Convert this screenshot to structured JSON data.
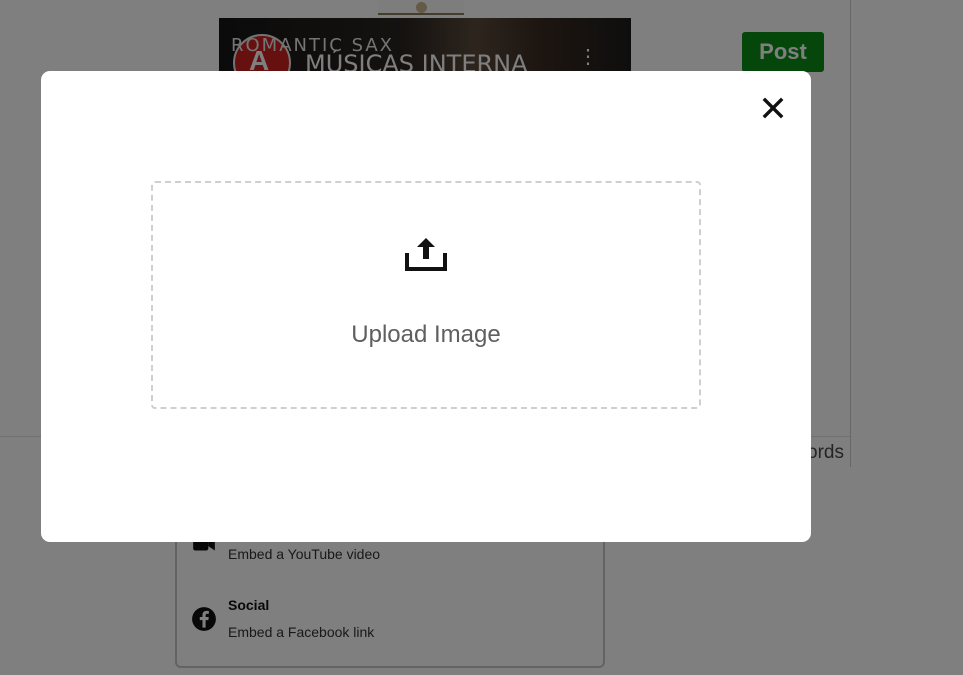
{
  "background": {
    "video_embed": {
      "channel_text": "ROMANTIC SAX",
      "title": "MÚSICAS INTERNA"
    },
    "post_button_label": "Post",
    "word_count_text": "ords",
    "embed_menu": {
      "items": [
        {
          "title": "",
          "description": "Embed a YouTube video",
          "icon": "video-camera-icon"
        },
        {
          "title": "Social",
          "description": "Embed a Facebook link",
          "icon": "facebook-icon"
        }
      ]
    }
  },
  "modal": {
    "upload_label": "Upload Image",
    "upload_icon": "upload-icon",
    "close_icon": "close-icon"
  },
  "colors": {
    "overlay": "#000000",
    "post_button": "#0a8f17",
    "modal_bg": "#ffffff",
    "dropzone_border": "#cfcfcf"
  }
}
